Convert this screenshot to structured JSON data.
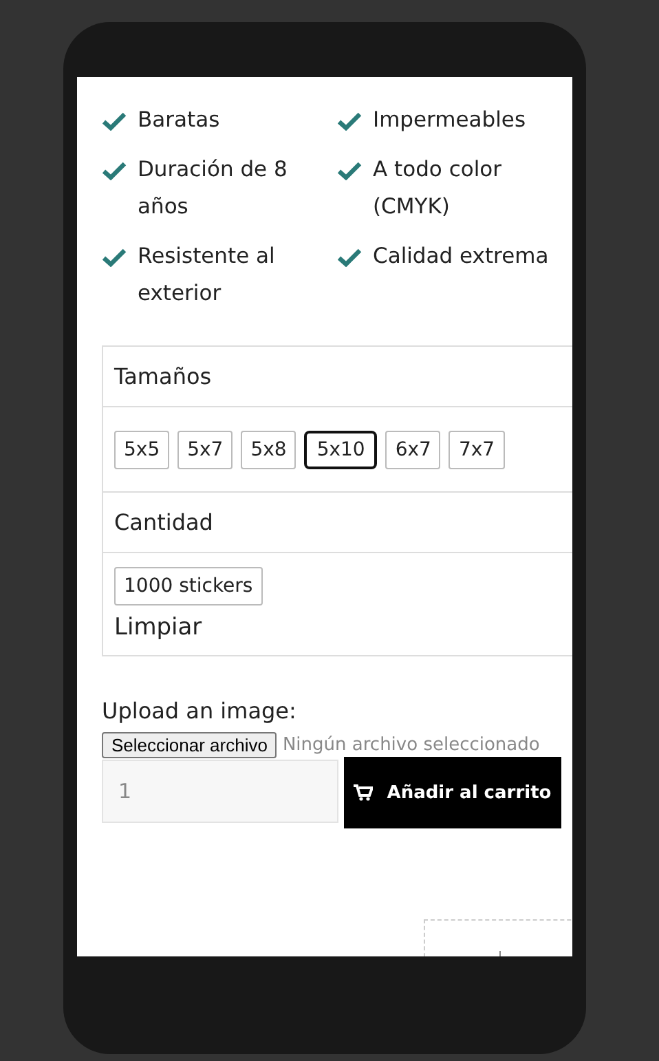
{
  "features": [
    {
      "text": "Baratas"
    },
    {
      "text": "Impermeables"
    },
    {
      "text": "Duración de 8 años"
    },
    {
      "text": "A todo color (CMYK)"
    },
    {
      "text": "Resistente al exterior"
    },
    {
      "text": "Calidad extrema"
    }
  ],
  "sizes": {
    "label": "Tamaños",
    "options": [
      {
        "label": "5x5",
        "selected": false
      },
      {
        "label": "5x7",
        "selected": false
      },
      {
        "label": "5x8",
        "selected": false
      },
      {
        "label": "5x10",
        "selected": true
      },
      {
        "label": "6x7",
        "selected": false
      },
      {
        "label": "7x7",
        "selected": false
      }
    ]
  },
  "quantity": {
    "label": "Cantidad",
    "options": [
      {
        "label": "1000 stickers",
        "selected": false
      }
    ],
    "clear": "Limpiar"
  },
  "upload": {
    "label": "Upload an image:",
    "button": "Seleccionar archivo",
    "status": "Ningún archivo seleccionado"
  },
  "qty_input": {
    "value": "1"
  },
  "add_to_cart": "Añadir al carrito"
}
